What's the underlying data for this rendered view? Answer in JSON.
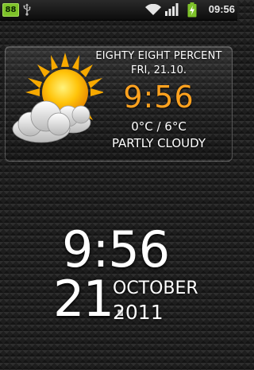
{
  "status_bar": {
    "notification_badge": "88",
    "time": "09:56",
    "icons": [
      "usb-icon",
      "wifi-icon",
      "signal-icon",
      "battery-charging-icon"
    ],
    "colors": {
      "badge": "#7ec22a",
      "battery": "#7ec22a"
    }
  },
  "weather_widget": {
    "location": "EIGHTY EIGHT PERCENT",
    "date": "FRI, 21.10.",
    "time": "9:56",
    "temperature": "0°C / 6°C",
    "condition": "PARTLY CLOUDY",
    "icon": "partly-cloudy-icon",
    "colors": {
      "time": "#ffa21f",
      "sun": "#ffc40a"
    }
  },
  "clock_widget": {
    "time": "9:56",
    "day": "21.",
    "month": "OCTOBER",
    "year": "2011"
  }
}
